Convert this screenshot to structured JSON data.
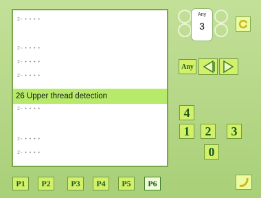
{
  "list": {
    "rows": [
      {
        "text": "2▫ • • • •"
      },
      {
        "text": "2▫ • • • •"
      },
      {
        "text": "2▫ • • • •"
      },
      {
        "text": "2▫ • • • •"
      },
      {
        "text": "26 Upper thread detection"
      },
      {
        "text": "2▫ • • • •"
      },
      {
        "text": "2▫ • • • •"
      },
      {
        "text": "2▫ • • • •"
      }
    ]
  },
  "selector": {
    "label": "Any",
    "value": "3"
  },
  "controls": {
    "any_button": "Any",
    "keypad": [
      "4",
      "1",
      "2",
      "3",
      "0"
    ]
  },
  "pages": [
    "P1",
    "P2",
    "P3",
    "P4",
    "P5",
    "P6"
  ],
  "colors": {
    "background": "#b9d98b",
    "highlight": "#b7ea6a",
    "button": "#d2f06a",
    "text_dark": "#1f5a1f"
  },
  "icons": [
    "refresh-icon",
    "left-arrow-icon",
    "right-arrow-icon",
    "enter-icon"
  ]
}
